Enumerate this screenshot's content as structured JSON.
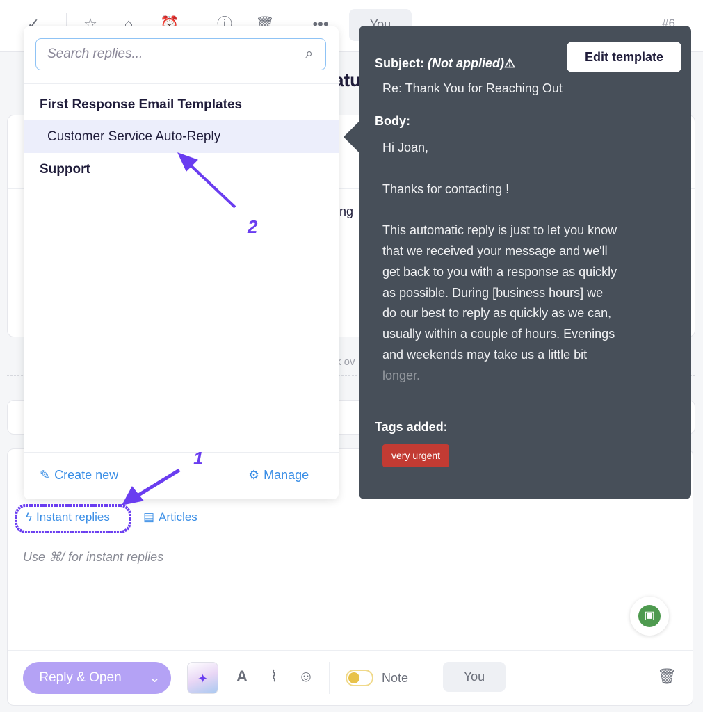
{
  "toolbar": {
    "you_label": "You",
    "ticket_number": "#6"
  },
  "background": {
    "fragment_heading": "atu",
    "fragment_line": "ng",
    "fragment_note": "k ov"
  },
  "dropdown": {
    "search_placeholder": "Search replies...",
    "groups": [
      {
        "label": "First Response Email Templates",
        "items": [
          {
            "label": "Customer Service Auto-Reply",
            "selected": true
          }
        ]
      },
      {
        "label": "Support",
        "items": []
      }
    ],
    "create_new": "Create new",
    "manage": "Manage"
  },
  "preview": {
    "subject_label": "Subject:",
    "subject_status": "(Not applied)",
    "subject": "Re: Thank You for Reaching Out",
    "body_label": "Body:",
    "body_lines": [
      "Hi Joan,",
      "",
      "Thanks for contacting !",
      "",
      "This automatic reply is just to let you know",
      "that we received your message and we'll",
      "get back to you with a response as quickly",
      "as possible. During [business hours] we",
      "do our best to reply as quickly as we can,",
      "usually within a couple of hours. Evenings",
      "and weekends may take us a little bit",
      "longer."
    ],
    "edit_button": "Edit template",
    "tags_label": "Tags added:",
    "tags": [
      {
        "label": "very urgent",
        "color": "#c23b33"
      }
    ]
  },
  "composer": {
    "instant_replies": "Instant replies",
    "articles": "Articles",
    "placeholder": "Use ⌘/ for instant replies",
    "reply_button": "Reply & Open",
    "note_label": "Note",
    "assignee": "You",
    "note_toggle_on": false
  },
  "annotations": {
    "step1": "1",
    "step2": "2",
    "color": "#6a3df0"
  }
}
